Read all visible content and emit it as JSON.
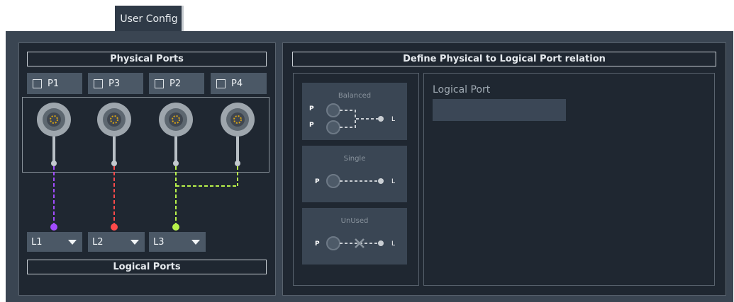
{
  "tab": {
    "label": "User Config"
  },
  "physical_ports": {
    "title": "Physical Ports",
    "ports": [
      {
        "label": "P1",
        "checked": false
      },
      {
        "label": "P3",
        "checked": false
      },
      {
        "label": "P2",
        "checked": false
      },
      {
        "label": "P4",
        "checked": false
      }
    ]
  },
  "logical_ports": {
    "title": "Logical Ports",
    "selects": [
      {
        "value": "L1",
        "color": "#a14cff"
      },
      {
        "value": "L2",
        "color": "#ff4a4a"
      },
      {
        "value": "L3",
        "color": "#b8f24a"
      }
    ]
  },
  "relation": {
    "title": "Define Physical to Logical Port relation",
    "modes": [
      {
        "label": "Balanced",
        "p_label": "P",
        "l_label": "L"
      },
      {
        "label": "Single",
        "p_label": "P",
        "l_label": "L"
      },
      {
        "label": "UnUsed",
        "p_label": "P",
        "l_label": "L"
      }
    ],
    "logical_port_label": "Logical Port",
    "logical_port_value": ""
  }
}
